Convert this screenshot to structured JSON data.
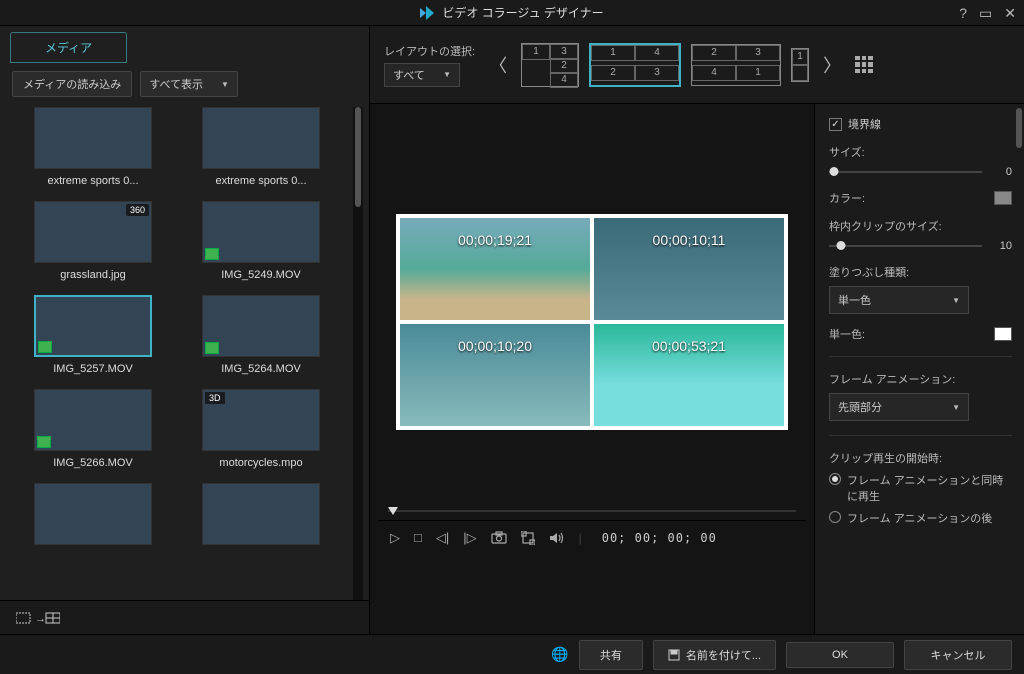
{
  "title": "ビデオ コラージュ デザイナー",
  "left": {
    "tab": "メディア",
    "import_btn": "メディアの読み込み",
    "filter": "すべて表示",
    "items": [
      {
        "cap": "extreme sports 0...",
        "cls": "sky"
      },
      {
        "cap": "extreme sports 0...",
        "cls": "snow"
      },
      {
        "cap": "grassland.jpg",
        "cls": "grass",
        "badge": "360"
      },
      {
        "cap": "IMG_5249.MOV",
        "cls": "uw1",
        "bl": true
      },
      {
        "cap": "IMG_5257.MOV",
        "cls": "uw2",
        "bl": true,
        "selected": true
      },
      {
        "cap": "IMG_5264.MOV",
        "cls": "uw3",
        "bl": true
      },
      {
        "cap": "IMG_5266.MOV",
        "cls": "uw4",
        "bl": true
      },
      {
        "cap": "motorcycles.mpo",
        "cls": "moto",
        "tl": "3D"
      },
      {
        "cap": "",
        "cls": "black"
      },
      {
        "cap": "",
        "cls": "city"
      }
    ]
  },
  "layoutbar": {
    "label": "レイアウトの選択:",
    "filter": "すべて",
    "tiles": [
      {
        "cells": [
          "1",
          "3",
          "",
          "2",
          "",
          "4"
        ],
        "cols": 2,
        "rows": 3
      },
      {
        "cells": [
          "1",
          "4",
          "2",
          "3"
        ],
        "cols": 2,
        "rows": 2,
        "selected": true
      },
      {
        "cells": [
          "2",
          "3",
          "4",
          "1"
        ],
        "cols": 2,
        "rows": 2
      },
      {
        "cells": [
          "1"
        ],
        "cols": 1,
        "rows": 1,
        "partial": true
      }
    ]
  },
  "preview": {
    "tc": [
      "00;00;19;21",
      "00;00;10;11",
      "00;00;10;20",
      "00;00;53;21"
    ],
    "time": "00; 00; 00; 00"
  },
  "props": {
    "border_chk": "境界線",
    "size_lbl": "サイズ:",
    "size_val": "0",
    "color_lbl": "カラー:",
    "inner_lbl": "枠内クリップのサイズ:",
    "inner_val": "10",
    "fill_lbl": "塗りつぶし種類:",
    "fill_sel": "単一色",
    "single_lbl": "単一色:",
    "frameanim_lbl": "フレーム アニメーション:",
    "frameanim_sel": "先頭部分",
    "clipstart_lbl": "クリップ再生の開始時:",
    "r1": "フレーム アニメーションと同時に再生",
    "r2": "フレーム アニメーションの後"
  },
  "bottom": {
    "share": "共有",
    "save": "名前を付けて...",
    "ok": "OK",
    "cancel": "キャンセル"
  }
}
